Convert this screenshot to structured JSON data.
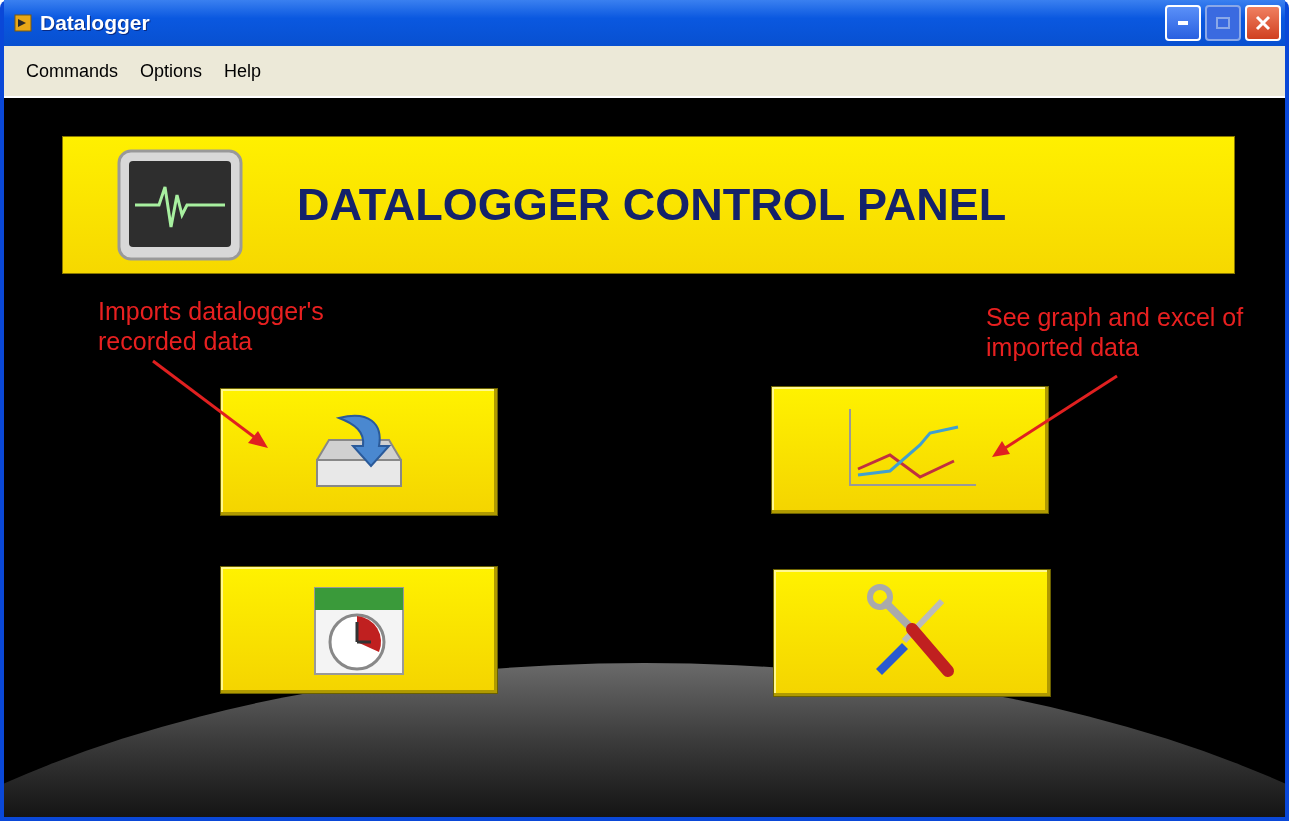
{
  "window": {
    "title": "Datalogger"
  },
  "menu": [
    {
      "label": "Commands"
    },
    {
      "label": "Options"
    },
    {
      "label": "Help"
    }
  ],
  "banner": {
    "title": "DATALOGGER CONTROL PANEL"
  },
  "columns": [
    {
      "note": "Imports datalogger's recorded data",
      "buttons": [
        {
          "kind": "import"
        },
        {
          "kind": "schedule"
        }
      ]
    },
    {
      "note": "See graph and excel of imported data",
      "buttons": [
        {
          "kind": "chart"
        },
        {
          "kind": "tools"
        }
      ]
    }
  ]
}
